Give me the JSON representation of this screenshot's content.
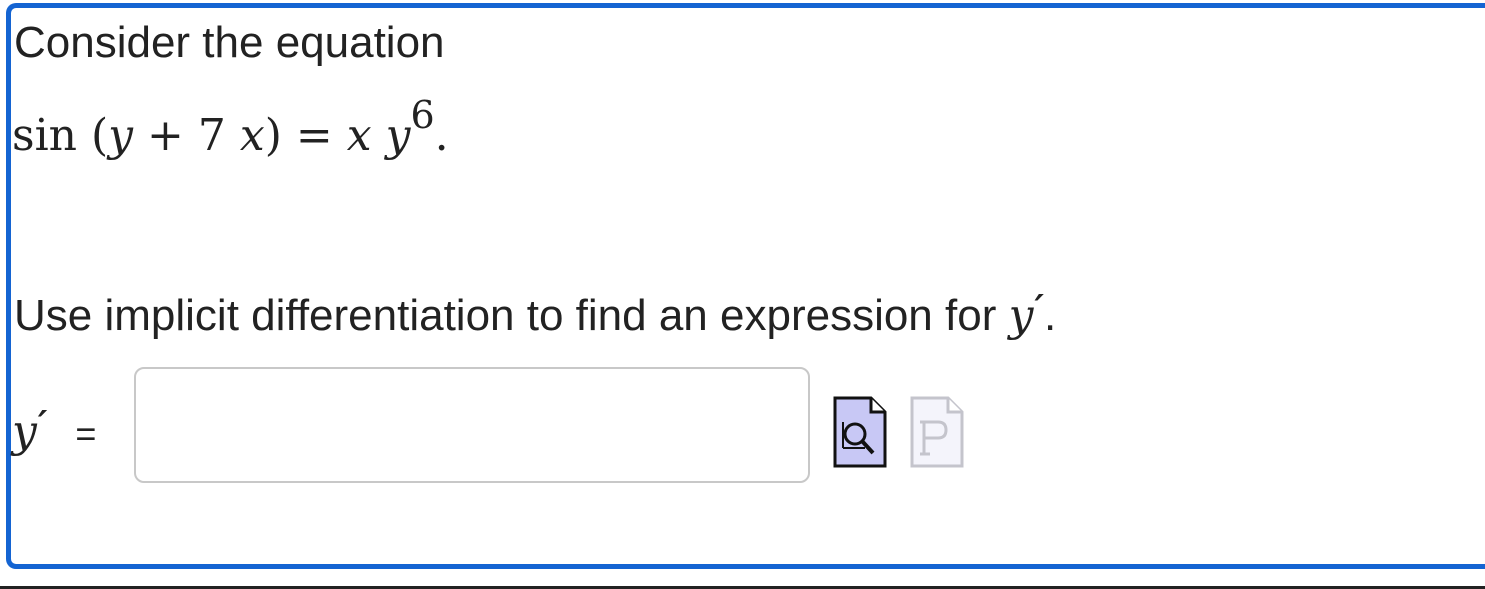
{
  "intro_text": "Consider the equation",
  "equation": {
    "fn": "sin",
    "open": "(",
    "y": "y",
    "plus": "+",
    "coef": "7",
    "x": "x",
    "close": ")",
    "equals": "=",
    "rhs_x": "x",
    "rhs_y": "y",
    "rhs_exp": "6",
    "period": "."
  },
  "instruction": {
    "text": "Use implicit differentiation to find an expression for ",
    "var": "y",
    "prime": "′",
    "period": "."
  },
  "answer": {
    "label_var": "y",
    "label_prime": "′",
    "label_eq": "=",
    "value": "",
    "placeholder": ""
  },
  "icons": {
    "preview": "preview-document-icon",
    "paste": "paste-document-icon",
    "preview_color": "#c8c8f5",
    "paste_color": "#f4f4fb"
  },
  "colors": {
    "frame_border": "#1464d2",
    "text": "#222222"
  }
}
